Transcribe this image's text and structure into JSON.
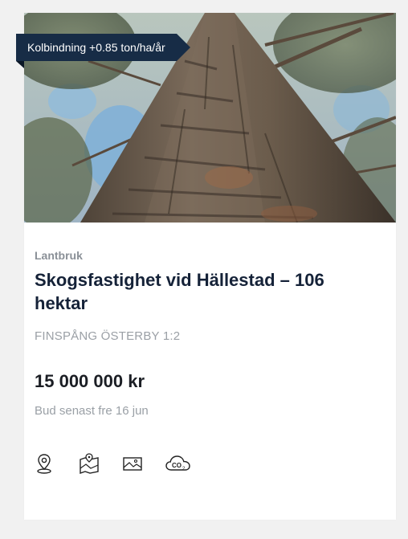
{
  "listing": {
    "badge": "Kolbindning +0.85 ton/ha/år",
    "category": "Lantbruk",
    "title": "Skogsfastighet vid Hällestad – 106 hektar",
    "location": "FINSPÅNG ÖSTERBY 1:2",
    "price": "15 000 000 kr",
    "deadline": "Bud senast fre 16 jun",
    "icons": [
      "location-pin-icon",
      "map-icon",
      "image-gallery-icon",
      "co2-cloud-icon"
    ]
  },
  "colors": {
    "badge_bg": "#172c46",
    "title": "#152238",
    "muted": "#9ba0a6",
    "page_bg": "#f1f1f1"
  }
}
